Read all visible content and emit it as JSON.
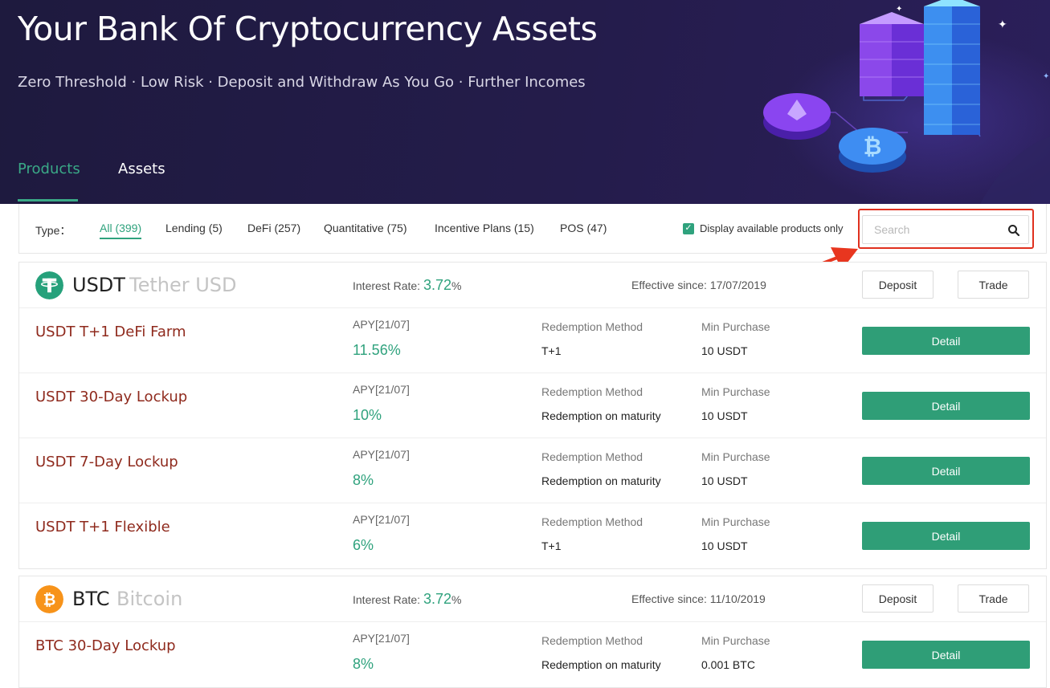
{
  "hero": {
    "title": "Your Bank Of Cryptocurrency Assets",
    "subtitle": "Zero Threshold · Low Risk · Deposit and Withdraw As You Go · Further Incomes",
    "tabs": [
      {
        "label": "Products",
        "active": true
      },
      {
        "label": "Assets",
        "active": false
      }
    ]
  },
  "filters": {
    "type_label": "Type：",
    "items": [
      {
        "label": "All (399)",
        "active": true
      },
      {
        "label": "Lending (5)",
        "active": false
      },
      {
        "label": "DeFi (257)",
        "active": false
      },
      {
        "label": "Quantitative (75)",
        "active": false
      },
      {
        "label": "Incentive Plans (15)",
        "active": false
      },
      {
        "label": "POS (47)",
        "active": false
      }
    ],
    "available_only_label": "Display available products only",
    "available_only_checked": true,
    "search_placeholder": "Search"
  },
  "coins": [
    {
      "symbol": "USDT",
      "name": "Tether USD",
      "interest_label": "Interest Rate:",
      "interest_value": "3.72",
      "interest_unit": "%",
      "effective": "Effective since: 17/07/2019",
      "deposit_label": "Deposit",
      "trade_label": "Trade",
      "icon": "tether-icon",
      "icon_color": "#26a17b",
      "products": [
        {
          "name": "USDT T+1 DeFi Farm",
          "apy_label": "APY[21/07]",
          "apy": "11.56%",
          "redemption_label": "Redemption Method",
          "redemption": "T+1",
          "min_label": "Min Purchase",
          "min": "10 USDT",
          "detail_label": "Detail"
        },
        {
          "name": "USDT 30-Day Lockup",
          "apy_label": "APY[21/07]",
          "apy": "10%",
          "redemption_label": "Redemption Method",
          "redemption": "Redemption on maturity",
          "min_label": "Min Purchase",
          "min": "10 USDT",
          "detail_label": "Detail"
        },
        {
          "name": "USDT 7-Day Lockup",
          "apy_label": "APY[21/07]",
          "apy": "8%",
          "redemption_label": "Redemption Method",
          "redemption": "Redemption on maturity",
          "min_label": "Min Purchase",
          "min": "10 USDT",
          "detail_label": "Detail"
        },
        {
          "name": "USDT T+1 Flexible",
          "apy_label": "APY[21/07]",
          "apy": "6%",
          "redemption_label": "Redemption Method",
          "redemption": "T+1",
          "min_label": "Min Purchase",
          "min": "10 USDT",
          "detail_label": "Detail"
        }
      ]
    },
    {
      "symbol": "BTC",
      "name": "Bitcoin",
      "interest_label": "Interest Rate:",
      "interest_value": "3.72",
      "interest_unit": "%",
      "effective": "Effective since: 11/10/2019",
      "deposit_label": "Deposit",
      "trade_label": "Trade",
      "icon": "bitcoin-icon",
      "icon_color": "#f7931a",
      "products": [
        {
          "name": "BTC 30-Day Lockup",
          "apy_label": "APY[21/07]",
          "apy": "8%",
          "redemption_label": "Redemption Method",
          "redemption": "Redemption on maturity",
          "min_label": "Min Purchase",
          "min": "0.001 BTC",
          "detail_label": "Detail"
        }
      ]
    }
  ],
  "colors": {
    "accent": "#2fa27d",
    "product_name": "#8f2a1d",
    "hero_bg": "#1e1a3e",
    "highlight": "#e0301e"
  }
}
